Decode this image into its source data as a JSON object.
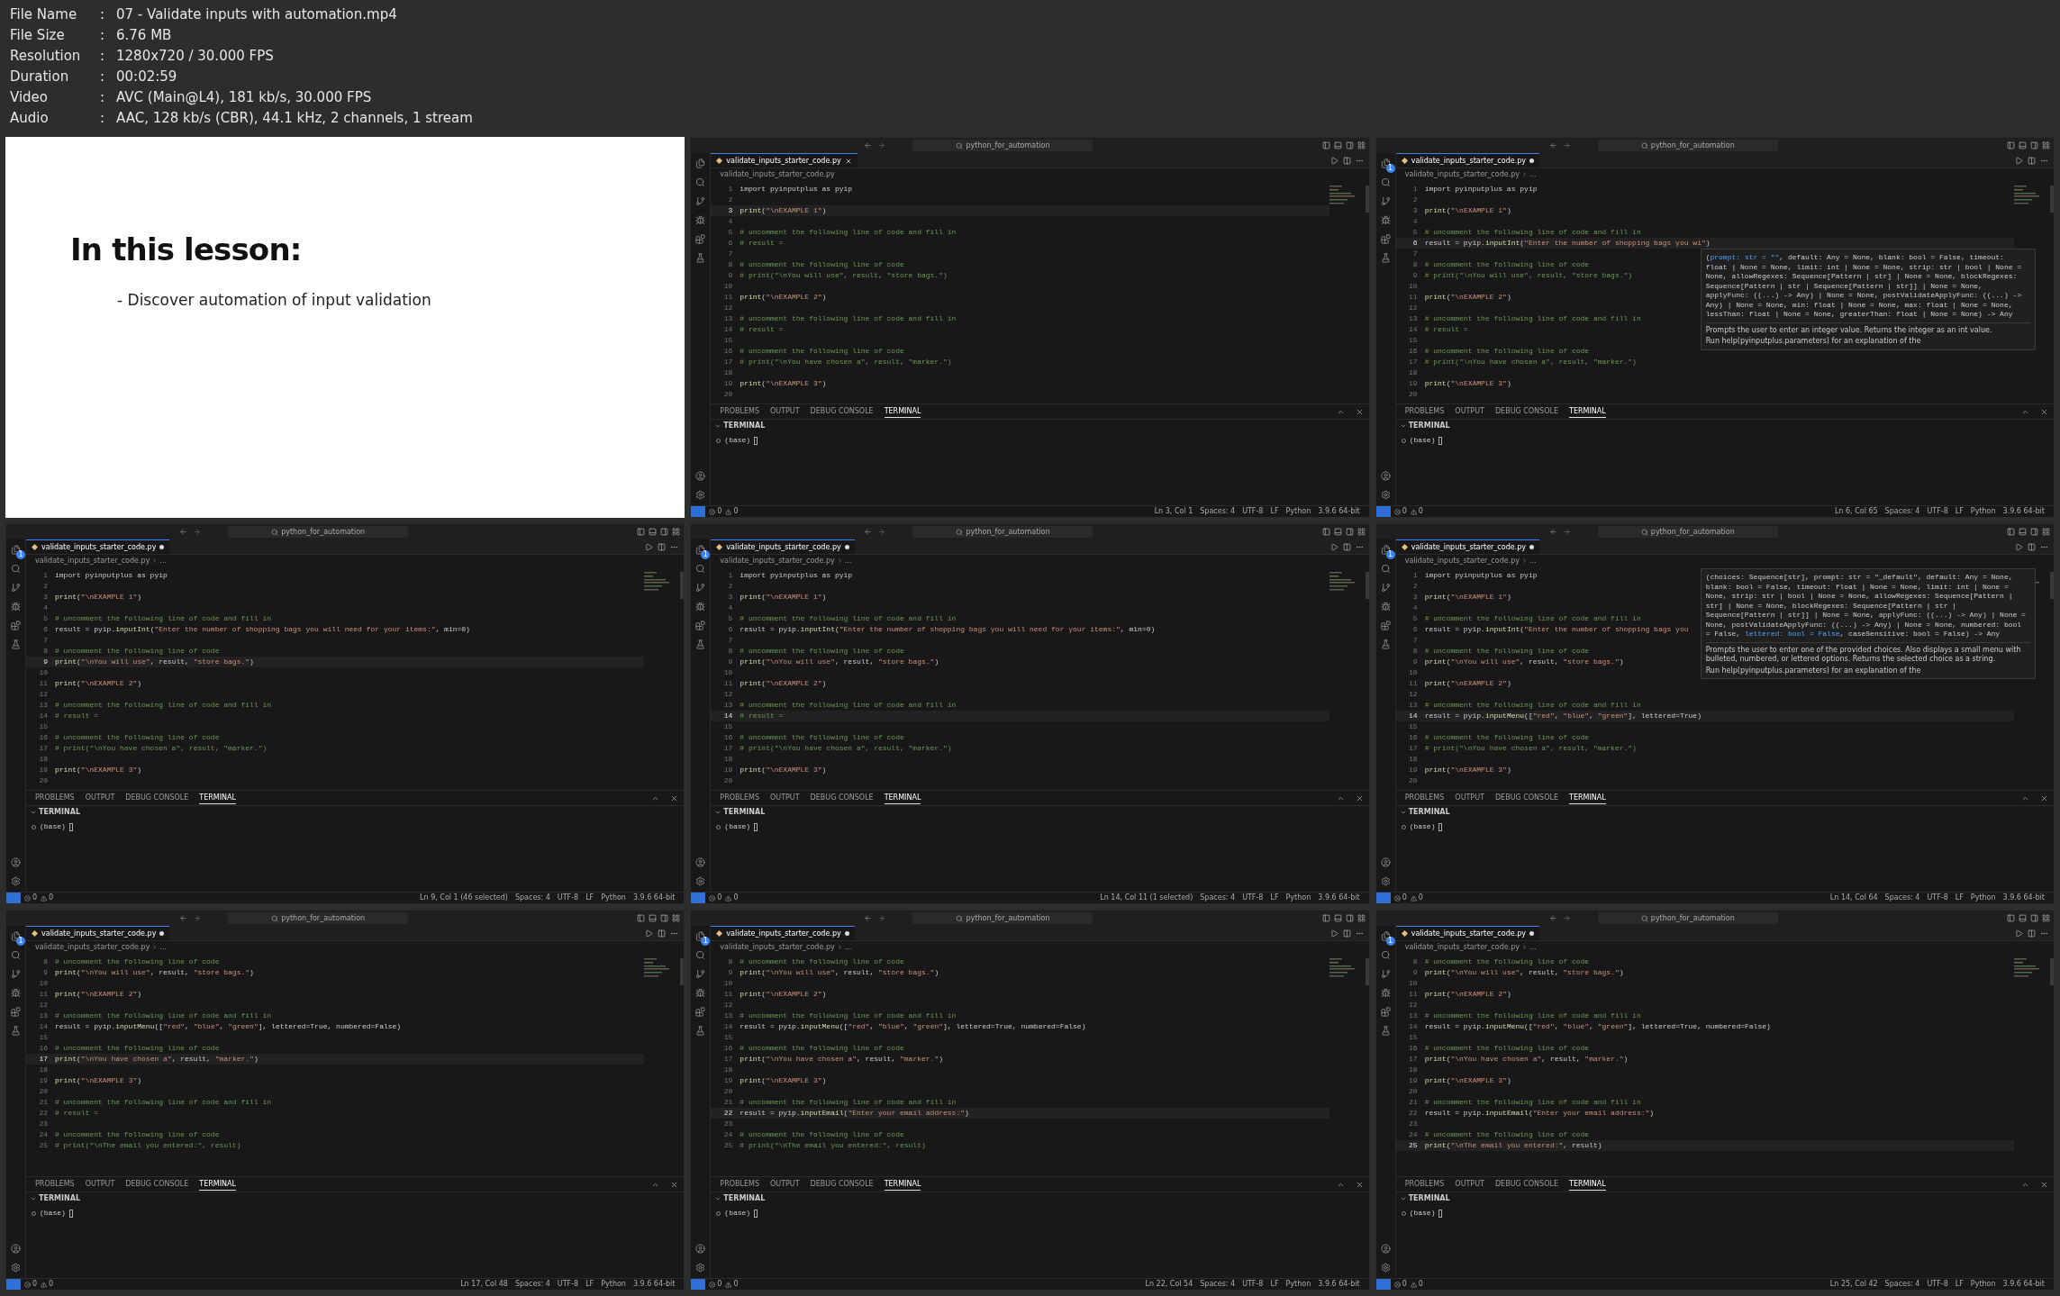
{
  "header": [
    {
      "label": "File Name",
      "separator": ":",
      "value": "07 - Validate inputs with automation.mp4"
    },
    {
      "label": "File Size",
      "separator": ":",
      "value": "6.76 MB"
    },
    {
      "label": "Resolution",
      "separator": ":",
      "value": "1280x720 / 30.000 FPS"
    },
    {
      "label": "Duration",
      "separator": ":",
      "value": "00:02:59"
    },
    {
      "label": "Video",
      "separator": ":",
      "value": "AVC (Main@L4), 181 kb/s, 30.000 FPS"
    },
    {
      "label": "Audio",
      "separator": ":",
      "value": "AAC, 128 kb/s (CBR), 44.1 kHz, 2 channels, 1 stream"
    }
  ],
  "frames": [
    {
      "kind": "slide",
      "title": "In this lesson:",
      "bullets": [
        "- Discover automation of input validation"
      ]
    },
    {
      "kind": "editor",
      "search": "python_for_automation",
      "tab": {
        "label": "validate_inputs_starter_code.py",
        "modified": false
      },
      "breadcrumb": [
        "validate_inputs_starter_code.py"
      ],
      "lines": [
        {
          "n": "1",
          "text": "import pyinputplus as pyip",
          "active": false
        },
        {
          "n": "2",
          "active": false
        },
        {
          "n": "3",
          "text": "print(\"\\nEXAMPLE 1\")",
          "active": true
        },
        {
          "n": "4",
          "active": false
        },
        {
          "n": "5",
          "text": "# uncomment the following line of code and fill in",
          "active": false
        },
        {
          "n": "6",
          "text": "# result =",
          "active": false
        },
        {
          "n": "7",
          "active": false
        },
        {
          "n": "8",
          "text": "# uncomment the following line of code",
          "active": false
        },
        {
          "n": "9",
          "text": "# print(\"\\nYou will use\", result, \"store bags.\")",
          "active": false
        },
        {
          "n": "10",
          "active": false
        },
        {
          "n": "11",
          "text": "print(\"\\nEXAMPLE 2\")",
          "active": false
        },
        {
          "n": "12",
          "active": false
        },
        {
          "n": "13",
          "text": "# uncomment the following line of code and fill in",
          "active": false
        },
        {
          "n": "14",
          "text": "# result =",
          "active": false
        },
        {
          "n": "15",
          "active": false
        },
        {
          "n": "16",
          "text": "# uncomment the following line of code",
          "active": false
        },
        {
          "n": "17",
          "text": "# print(\"\\nYou have chosen a\", result, \"marker.\")",
          "active": false
        },
        {
          "n": "18",
          "active": false
        },
        {
          "n": "19",
          "text": "print(\"\\nEXAMPLE 3\")",
          "active": false
        },
        {
          "n": "20",
          "active": false
        }
      ],
      "panel_tabs": [
        {
          "label": "PROBLEMS",
          "selected": false
        },
        {
          "label": "OUTPUT",
          "selected": false
        },
        {
          "label": "DEBUG CONSOLE",
          "selected": false
        },
        {
          "label": "TERMINAL",
          "selected": true
        }
      ],
      "terminal_title": "TERMINAL",
      "prompt": "(base)",
      "problems": [
        {
          "kind": "error",
          "count": "0"
        },
        {
          "kind": "warning",
          "count": "0"
        }
      ],
      "status": [
        "Ln 3, Col 1",
        "Spaces: 4",
        "UTF-8",
        "LF",
        "Python",
        "3.9.6 64-bit"
      ]
    },
    {
      "kind": "editor",
      "search": "python_for_automation",
      "explorer_badge": "1",
      "tab": {
        "label": "validate_inputs_starter_code.py",
        "modified": true
      },
      "breadcrumb": [
        "validate_inputs_starter_code.py",
        "..."
      ],
      "lines": [
        {
          "n": "1",
          "text": "import pyinputplus as pyip",
          "active": false
        },
        {
          "n": "2",
          "active": false
        },
        {
          "n": "3",
          "text": "print(\"\\nEXAMPLE 1\")",
          "active": false
        },
        {
          "n": "4",
          "active": false
        },
        {
          "n": "5",
          "text": "# uncomment the following line of code and fill in",
          "active": false
        },
        {
          "n": "6",
          "text": "result = pyip.inputInt(\"Enter the number of shopping bags you wi\")",
          "active": true
        },
        {
          "n": "7",
          "active": false
        },
        {
          "n": "8",
          "text": "# uncomment the following line of code",
          "active": false
        },
        {
          "n": "9",
          "text": "# print(\"\\nYou will use\", result, \"store bags.\")",
          "active": false
        },
        {
          "n": "10",
          "active": false
        },
        {
          "n": "11",
          "text": "print(\"\\nEXAMPLE 2\")",
          "active": false
        },
        {
          "n": "12",
          "active": false
        },
        {
          "n": "13",
          "text": "# uncomment the following line of code and fill in",
          "active": false
        },
        {
          "n": "14",
          "text": "# result =",
          "active": false
        },
        {
          "n": "15",
          "active": false
        },
        {
          "n": "16",
          "text": "# uncomment the following line of code",
          "active": false
        },
        {
          "n": "17",
          "text": "# print(\"\\nYou have chosen a\", result, \"marker.\")",
          "active": false
        },
        {
          "n": "18",
          "active": false
        },
        {
          "n": "19",
          "text": "print(\"\\nEXAMPLE 3\")",
          "active": false
        },
        {
          "n": "20",
          "active": false
        }
      ],
      "tooltip": {
        "above": false,
        "before": "(",
        "parameter": "prompt: str = \"\"",
        "after": ", default: Any = None, blank: bool = False, timeout: float | None = None, limit: int | None = None, strip: str | bool | None = None, allowRegexes: Sequence[Pattern | str] | None = None, blockRegexes: Sequence[Pattern | str | Sequence[Pattern | str]] | None = None, applyFunc: ((...) -> Any) | None = None, postValidateApplyFunc: ((...) -> Any) | None = None, min: float | None = None, max: float | None = None, lessThan: float | None = None, greaterThan: float | None = None) -> Any",
        "description": "Prompts the user to enter an integer value. Returns the integer as an int value.",
        "footer": "Run help(pyinputplus.parameters) for an explanation of the"
      },
      "panel_tabs": [
        {
          "label": "PROBLEMS",
          "selected": false
        },
        {
          "label": "OUTPUT",
          "selected": false
        },
        {
          "label": "DEBUG CONSOLE",
          "selected": false
        },
        {
          "label": "TERMINAL",
          "selected": true
        }
      ],
      "terminal_title": "TERMINAL",
      "prompt": "(base)",
      "problems": [
        {
          "kind": "error",
          "count": "0"
        },
        {
          "kind": "warning",
          "count": "0"
        }
      ],
      "status": [
        "Ln 6, Col 65",
        "Spaces: 4",
        "UTF-8",
        "LF",
        "Python",
        "3.9.6 64-bit"
      ]
    },
    {
      "kind": "editor",
      "search": "python_for_automation",
      "explorer_badge": "1",
      "tab": {
        "label": "validate_inputs_starter_code.py",
        "modified": true
      },
      "breadcrumb": [
        "validate_inputs_starter_code.py",
        "..."
      ],
      "lines": [
        {
          "n": "1",
          "text": "import pyinputplus as pyip",
          "active": false
        },
        {
          "n": "2",
          "active": false
        },
        {
          "n": "3",
          "text": "print(\"\\nEXAMPLE 1\")",
          "active": false
        },
        {
          "n": "4",
          "active": false
        },
        {
          "n": "5",
          "text": "# uncomment the following line of code and fill in",
          "active": false
        },
        {
          "n": "6",
          "text": "result = pyip.inputInt(\"Enter the number of shopping bags you will need for your items:\", min=0)",
          "active": false
        },
        {
          "n": "7",
          "active": false
        },
        {
          "n": "8",
          "text": "# uncomment the following line of code",
          "active": false
        },
        {
          "n": "9",
          "text": "print(\"\\nYou will use\", result, \"store bags.\")",
          "active": true
        },
        {
          "n": "10",
          "active": false
        },
        {
          "n": "11",
          "text": "print(\"\\nEXAMPLE 2\")",
          "active": false
        },
        {
          "n": "12",
          "active": false
        },
        {
          "n": "13",
          "text": "# uncomment the following line of code and fill in",
          "active": false
        },
        {
          "n": "14",
          "text": "# result =",
          "active": false
        },
        {
          "n": "15",
          "active": false
        },
        {
          "n": "16",
          "text": "# uncomment the following line of code",
          "active": false
        },
        {
          "n": "17",
          "text": "# print(\"\\nYou have chosen a\", result, \"marker.\")",
          "active": false
        },
        {
          "n": "18",
          "active": false
        },
        {
          "n": "19",
          "text": "print(\"\\nEXAMPLE 3\")",
          "active": false
        },
        {
          "n": "20",
          "active": false
        }
      ],
      "panel_tabs": [
        {
          "label": "PROBLEMS",
          "selected": false
        },
        {
          "label": "OUTPUT",
          "selected": false
        },
        {
          "label": "DEBUG CONSOLE",
          "selected": false
        },
        {
          "label": "TERMINAL",
          "selected": true
        }
      ],
      "terminal_title": "TERMINAL",
      "prompt": "(base)",
      "problems": [
        {
          "kind": "error",
          "count": "0"
        },
        {
          "kind": "warning",
          "count": "0"
        }
      ],
      "status": [
        "Ln 9, Col 1 (46 selected)",
        "Spaces: 4",
        "UTF-8",
        "LF",
        "Python",
        "3.9.6 64-bit"
      ]
    },
    {
      "kind": "editor",
      "search": "python_for_automation",
      "explorer_badge": "1",
      "tab": {
        "label": "validate_inputs_starter_code.py",
        "modified": true
      },
      "breadcrumb": [
        "validate_inputs_starter_code.py",
        "..."
      ],
      "lines": [
        {
          "n": "1",
          "text": "import pyinputplus as pyip",
          "active": false
        },
        {
          "n": "2",
          "active": false
        },
        {
          "n": "3",
          "text": "print(\"\\nEXAMPLE 1\")",
          "active": false
        },
        {
          "n": "4",
          "active": false
        },
        {
          "n": "5",
          "text": "# uncomment the following line of code and fill in",
          "active": false
        },
        {
          "n": "6",
          "text": "result = pyip.inputInt(\"Enter the number of shopping bags you will need for your items:\", min=0)",
          "active": false
        },
        {
          "n": "7",
          "active": false
        },
        {
          "n": "8",
          "text": "# uncomment the following line of code",
          "active": false
        },
        {
          "n": "9",
          "text": "print(\"\\nYou will use\", result, \"store bags.\")",
          "active": false
        },
        {
          "n": "10",
          "active": false
        },
        {
          "n": "11",
          "text": "print(\"\\nEXAMPLE 2\")",
          "active": false
        },
        {
          "n": "12",
          "active": false
        },
        {
          "n": "13",
          "text": "# uncomment the following line of code and fill in",
          "active": false
        },
        {
          "n": "14",
          "text": "# result =",
          "active": true
        },
        {
          "n": "15",
          "active": false
        },
        {
          "n": "16",
          "text": "# uncomment the following line of code",
          "active": false
        },
        {
          "n": "17",
          "text": "# print(\"\\nYou have chosen a\", result, \"marker.\")",
          "active": false
        },
        {
          "n": "18",
          "active": false
        },
        {
          "n": "19",
          "text": "print(\"\\nEXAMPLE 3\")",
          "active": false
        },
        {
          "n": "20",
          "active": false
        }
      ],
      "panel_tabs": [
        {
          "label": "PROBLEMS",
          "selected": false
        },
        {
          "label": "OUTPUT",
          "selected": false
        },
        {
          "label": "DEBUG CONSOLE",
          "selected": false
        },
        {
          "label": "TERMINAL",
          "selected": true
        }
      ],
      "terminal_title": "TERMINAL",
      "prompt": "(base)",
      "problems": [
        {
          "kind": "error",
          "count": "0"
        },
        {
          "kind": "warning",
          "count": "0"
        }
      ],
      "status": [
        "Ln 14, Col 11 (1 selected)",
        "Spaces: 4",
        "UTF-8",
        "LF",
        "Python",
        "3.9.6 64-bit"
      ]
    },
    {
      "kind": "editor",
      "search": "python_for_automation",
      "explorer_badge": "1",
      "tab": {
        "label": "validate_inputs_starter_code.py",
        "modified": true
      },
      "breadcrumb": [
        "validate_inputs_starter_code.py",
        "..."
      ],
      "lines": [
        {
          "n": "1",
          "text": "import pyinputplus as pyip",
          "active": false
        },
        {
          "n": "2",
          "active": false
        },
        {
          "n": "3",
          "text": "print(\"\\nEXAMPLE 1\")",
          "active": false
        },
        {
          "n": "4",
          "active": false
        },
        {
          "n": "5",
          "text": "# uncomment the following line of code and fill in",
          "active": false
        },
        {
          "n": "6",
          "text": "result = pyip.inputInt(\"Enter the number of shopping bags you",
          "active": false
        },
        {
          "n": "7",
          "active": false
        },
        {
          "n": "8",
          "text": "# uncomment the following line of code",
          "active": false
        },
        {
          "n": "9",
          "text": "print(\"\\nYou will use\", result, \"store bags.\")",
          "active": false
        },
        {
          "n": "10",
          "active": false
        },
        {
          "n": "11",
          "text": "print(\"\\nEXAMPLE 2\")",
          "active": false
        },
        {
          "n": "12",
          "active": false
        },
        {
          "n": "13",
          "text": "# uncomment the following line of code and fill in",
          "active": false
        },
        {
          "n": "14",
          "text": "result = pyip.inputMenu([\"red\", \"blue\", \"green\"], lettered=True)",
          "active": true
        },
        {
          "n": "15",
          "active": false
        },
        {
          "n": "16",
          "text": "# uncomment the following line of code",
          "active": false
        },
        {
          "n": "17",
          "text": "# print(\"\\nYou have chosen a\", result, \"marker.\")",
          "active": false
        },
        {
          "n": "18",
          "active": false
        },
        {
          "n": "19",
          "text": "print(\"\\nEXAMPLE 3\")",
          "active": false
        },
        {
          "n": "20",
          "active": false
        }
      ],
      "tooltip": {
        "above": true,
        "before": "(choices: Sequence[str], prompt: str = \"_default\", default: Any = None, blank: bool = False, timeout: float | None = None, limit: int | None = None, strip: str | bool | None = None, allowRegexes: Sequence[Pattern | str] | None = None, blockRegexes: Sequence[Pattern | str | Sequence[Pattern | str]] | None = None, applyFunc: ((...) -> Any) | None = None, postValidateApplyFunc: ((...) -> Any) | None = None, numbered: bool = False, ",
        "parameter": "lettered: bool = False",
        "after": ", caseSensitive: bool = False) -> Any",
        "description": "Prompts the user to enter one of the provided choices. Also displays a small menu with bulleted, numbered, or lettered options. Returns the selected choice as a string.",
        "footer": "Run help(pyinputplus.parameters) for an explanation of the"
      },
      "panel_tabs": [
        {
          "label": "PROBLEMS",
          "selected": false
        },
        {
          "label": "OUTPUT",
          "selected": false
        },
        {
          "label": "DEBUG CONSOLE",
          "selected": false
        },
        {
          "label": "TERMINAL",
          "selected": true
        }
      ],
      "terminal_title": "TERMINAL",
      "prompt": "(base)",
      "problems": [
        {
          "kind": "error",
          "count": "0"
        },
        {
          "kind": "warning",
          "count": "0"
        }
      ],
      "status": [
        "Ln 14, Col 64",
        "Spaces: 4",
        "UTF-8",
        "LF",
        "Python",
        "3.9.6 64-bit"
      ]
    },
    {
      "kind": "editor",
      "search": "python_for_automation",
      "explorer_badge": "1",
      "tab": {
        "label": "validate_inputs_starter_code.py",
        "modified": true
      },
      "breadcrumb": [
        "validate_inputs_starter_code.py",
        "..."
      ],
      "lines": [
        {
          "n": "8",
          "text": "# uncomment the following line of code",
          "active": false
        },
        {
          "n": "9",
          "text": "print(\"\\nYou will use\", result, \"store bags.\")",
          "active": false
        },
        {
          "n": "10",
          "active": false
        },
        {
          "n": "11",
          "text": "print(\"\\nEXAMPLE 2\")",
          "active": false
        },
        {
          "n": "12",
          "active": false
        },
        {
          "n": "13",
          "text": "# uncomment the following line of code and fill in",
          "active": false
        },
        {
          "n": "14",
          "text": "result = pyip.inputMenu([\"red\", \"blue\", \"green\"], lettered=True, numbered=False)",
          "active": false
        },
        {
          "n": "15",
          "active": false
        },
        {
          "n": "16",
          "text": "# uncomment the following line of code",
          "active": false
        },
        {
          "n": "17",
          "text": "print(\"\\nYou have chosen a\", result, \"marker.\")",
          "active": true
        },
        {
          "n": "18",
          "active": false
        },
        {
          "n": "19",
          "text": "print(\"\\nEXAMPLE 3\")",
          "active": false
        },
        {
          "n": "20",
          "active": false
        },
        {
          "n": "21",
          "text": "# uncomment the following line of code and fill in",
          "active": false
        },
        {
          "n": "22",
          "text": "# result =",
          "active": false
        },
        {
          "n": "23",
          "active": false
        },
        {
          "n": "24",
          "text": "# uncomment the following line of code",
          "active": false
        },
        {
          "n": "25",
          "text": "# print(\"\\nThe email you entered:\", result)",
          "active": false
        }
      ],
      "panel_tabs": [
        {
          "label": "PROBLEMS",
          "selected": false
        },
        {
          "label": "OUTPUT",
          "selected": false
        },
        {
          "label": "DEBUG CONSOLE",
          "selected": false
        },
        {
          "label": "TERMINAL",
          "selected": true
        }
      ],
      "terminal_title": "TERMINAL",
      "prompt": "(base)",
      "problems": [
        {
          "kind": "error",
          "count": "0"
        },
        {
          "kind": "warning",
          "count": "0"
        }
      ],
      "status": [
        "Ln 17, Col 48",
        "Spaces: 4",
        "UTF-8",
        "LF",
        "Python",
        "3.9.6 64-bit"
      ]
    },
    {
      "kind": "editor",
      "search": "python_for_automation",
      "explorer_badge": "1",
      "tab": {
        "label": "validate_inputs_starter_code.py",
        "modified": true
      },
      "breadcrumb": [
        "validate_inputs_starter_code.py",
        "..."
      ],
      "lines": [
        {
          "n": "8",
          "text": "# uncomment the following line of code",
          "active": false
        },
        {
          "n": "9",
          "text": "print(\"\\nYou will use\", result, \"store bags.\")",
          "active": false
        },
        {
          "n": "10",
          "active": false
        },
        {
          "n": "11",
          "text": "print(\"\\nEXAMPLE 2\")",
          "active": false
        },
        {
          "n": "12",
          "active": false
        },
        {
          "n": "13",
          "text": "# uncomment the following line of code and fill in",
          "active": false
        },
        {
          "n": "14",
          "text": "result = pyip.inputMenu([\"red\", \"blue\", \"green\"], lettered=True, numbered=False)",
          "active": false
        },
        {
          "n": "15",
          "active": false
        },
        {
          "n": "16",
          "text": "# uncomment the following line of code",
          "active": false
        },
        {
          "n": "17",
          "text": "print(\"\\nYou have chosen a\", result, \"marker.\")",
          "active": false
        },
        {
          "n": "18",
          "active": false
        },
        {
          "n": "19",
          "text": "print(\"\\nEXAMPLE 3\")",
          "active": false
        },
        {
          "n": "20",
          "active": false
        },
        {
          "n": "21",
          "text": "# uncomment the following line of code and fill in",
          "active": false
        },
        {
          "n": "22",
          "text": "result = pyip.inputEmail(\"Enter your email address:\")",
          "active": true
        },
        {
          "n": "23",
          "active": false
        },
        {
          "n": "24",
          "text": "# uncomment the following line of code",
          "active": false
        },
        {
          "n": "25",
          "text": "# print(\"\\nThe email you entered:\", result)",
          "active": false
        }
      ],
      "panel_tabs": [
        {
          "label": "PROBLEMS",
          "selected": false
        },
        {
          "label": "OUTPUT",
          "selected": false
        },
        {
          "label": "DEBUG CONSOLE",
          "selected": false
        },
        {
          "label": "TERMINAL",
          "selected": true
        }
      ],
      "terminal_title": "TERMINAL",
      "prompt": "(base)",
      "problems": [
        {
          "kind": "error",
          "count": "0"
        },
        {
          "kind": "warning",
          "count": "0"
        }
      ],
      "status": [
        "Ln 22, Col 54",
        "Spaces: 4",
        "UTF-8",
        "LF",
        "Python",
        "3.9.6 64-bit"
      ]
    },
    {
      "kind": "editor",
      "search": "python_for_automation",
      "explorer_badge": "1",
      "tab": {
        "label": "validate_inputs_starter_code.py",
        "modified": true
      },
      "breadcrumb": [
        "validate_inputs_starter_code.py",
        "..."
      ],
      "lines": [
        {
          "n": "8",
          "text": "# uncomment the following line of code",
          "active": false
        },
        {
          "n": "9",
          "text": "print(\"\\nYou will use\", result, \"store bags.\")",
          "active": false
        },
        {
          "n": "10",
          "active": false
        },
        {
          "n": "11",
          "text": "print(\"\\nEXAMPLE 2\")",
          "active": false
        },
        {
          "n": "12",
          "active": false
        },
        {
          "n": "13",
          "text": "# uncomment the following line of code and fill in",
          "active": false
        },
        {
          "n": "14",
          "text": "result = pyip.inputMenu([\"red\", \"blue\", \"green\"], lettered=True, numbered=False)",
          "active": false
        },
        {
          "n": "15",
          "active": false
        },
        {
          "n": "16",
          "text": "# uncomment the following line of code",
          "active": false
        },
        {
          "n": "17",
          "text": "print(\"\\nYou have chosen a\", result, \"marker.\")",
          "active": false
        },
        {
          "n": "18",
          "active": false
        },
        {
          "n": "19",
          "text": "print(\"\\nEXAMPLE 3\")",
          "active": false
        },
        {
          "n": "20",
          "active": false
        },
        {
          "n": "21",
          "text": "# uncomment the following line of code and fill in",
          "active": false
        },
        {
          "n": "22",
          "text": "result = pyip.inputEmail(\"Enter your email address:\")",
          "active": false
        },
        {
          "n": "23",
          "active": false
        },
        {
          "n": "24",
          "text": "# uncomment the following line of code",
          "active": false
        },
        {
          "n": "25",
          "text": "print(\"\\nThe email you entered:\", result)",
          "active": true
        }
      ],
      "panel_tabs": [
        {
          "label": "PROBLEMS",
          "selected": false
        },
        {
          "label": "OUTPUT",
          "selected": false
        },
        {
          "label": "DEBUG CONSOLE",
          "selected": false
        },
        {
          "label": "TERMINAL",
          "selected": true
        }
      ],
      "terminal_title": "TERMINAL",
      "prompt": "(base)",
      "problems": [
        {
          "kind": "error",
          "count": "0"
        },
        {
          "kind": "warning",
          "count": "0"
        }
      ],
      "status": [
        "Ln 25, Col 42",
        "Spaces: 4",
        "UTF-8",
        "LF",
        "Python",
        "3.9.6 64-bit"
      ]
    }
  ]
}
